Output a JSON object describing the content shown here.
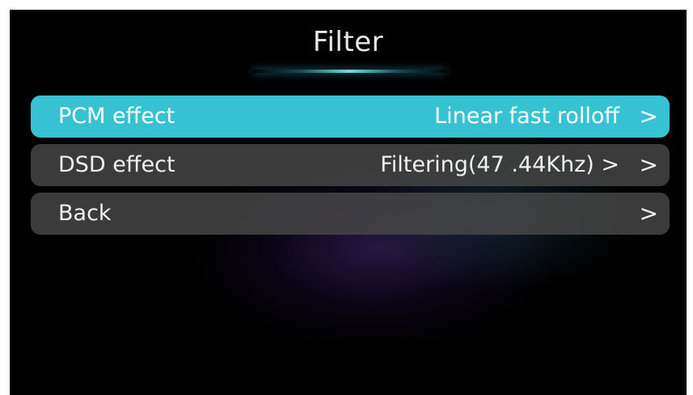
{
  "header": {
    "title": "Filter"
  },
  "menu": {
    "items": [
      {
        "label": "PCM effect",
        "value": "Linear fast rolloff",
        "chevron": ">",
        "selected": true
      },
      {
        "label": "DSD effect",
        "value": "Filtering(47 .44Khz) >",
        "chevron": ">",
        "selected": false
      },
      {
        "label": "Back",
        "value": "",
        "chevron": ">",
        "selected": false
      }
    ]
  },
  "colors": {
    "selected_row": "#37c2d3",
    "row_background": "#484848",
    "screen_background": "#000000"
  }
}
